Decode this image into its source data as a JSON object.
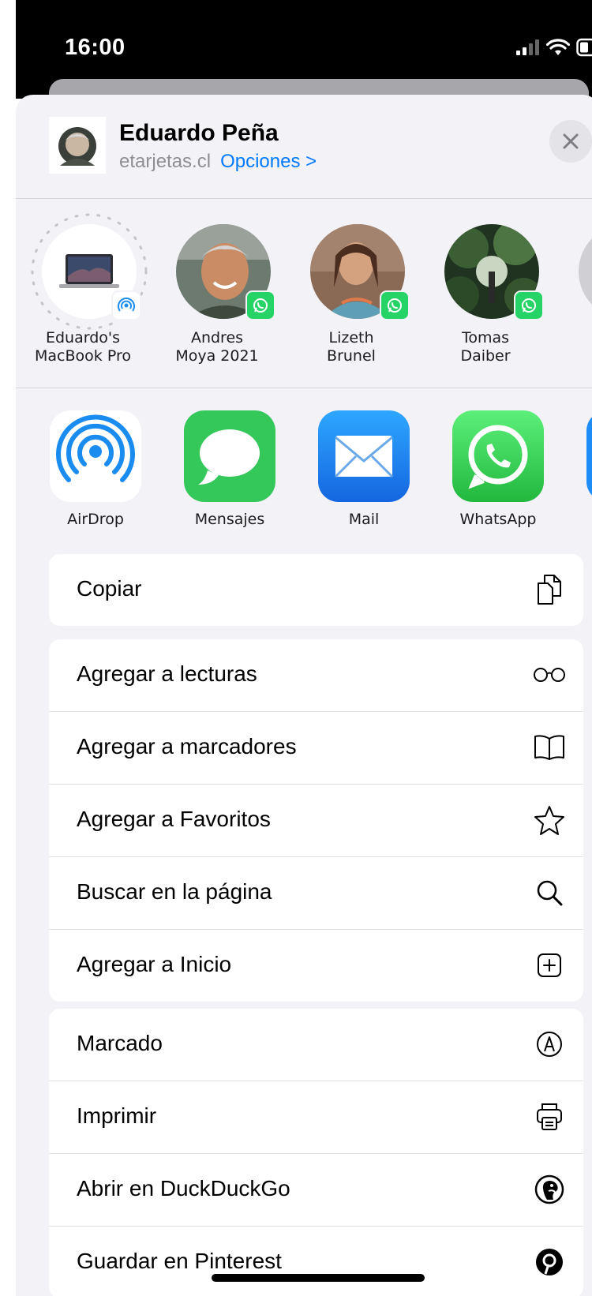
{
  "status_bar": {
    "time": "16:00"
  },
  "header": {
    "title": "Eduardo Peña",
    "domain": "etarjetas.cl",
    "options_label": "Opciones >"
  },
  "contacts": [
    {
      "name": "Eduardo's\nMacBook Pro",
      "badge": "airdrop-icon"
    },
    {
      "name": "Andres\nMoya 2021",
      "badge": "whatsapp-icon"
    },
    {
      "name": "Lizeth\nBrunel",
      "badge": "whatsapp-icon"
    },
    {
      "name": "Tomas\nDaiber",
      "badge": "whatsapp-icon"
    }
  ],
  "apps": [
    {
      "label": "AirDrop",
      "icon": "airdrop-icon"
    },
    {
      "label": "Mensajes",
      "icon": "messages-icon"
    },
    {
      "label": "Mail",
      "icon": "mail-icon"
    },
    {
      "label": "WhatsApp",
      "icon": "whatsapp-icon"
    }
  ],
  "actions": {
    "group1": [
      {
        "label": "Copiar",
        "icon": "copy-icon"
      }
    ],
    "group2": [
      {
        "label": "Agregar a lecturas",
        "icon": "glasses-icon"
      },
      {
        "label": "Agregar a marcadores",
        "icon": "book-icon"
      },
      {
        "label": "Agregar a Favoritos",
        "icon": "star-icon"
      },
      {
        "label": "Buscar en la página",
        "icon": "search-icon"
      },
      {
        "label": "Agregar a Inicio",
        "icon": "add-square-icon"
      }
    ],
    "group3": [
      {
        "label": "Marcado",
        "icon": "markup-icon"
      },
      {
        "label": "Imprimir",
        "icon": "printer-icon"
      },
      {
        "label": "Abrir en DuckDuckGo",
        "icon": "duckduckgo-icon"
      },
      {
        "label": "Guardar en Pinterest",
        "icon": "pinterest-icon"
      }
    ]
  },
  "colors": {
    "accent": "#007aff",
    "whatsapp": "#25d366",
    "messages": "#34c759",
    "mail": "#1e8cf7",
    "airdrop": "#1a8cf0"
  }
}
